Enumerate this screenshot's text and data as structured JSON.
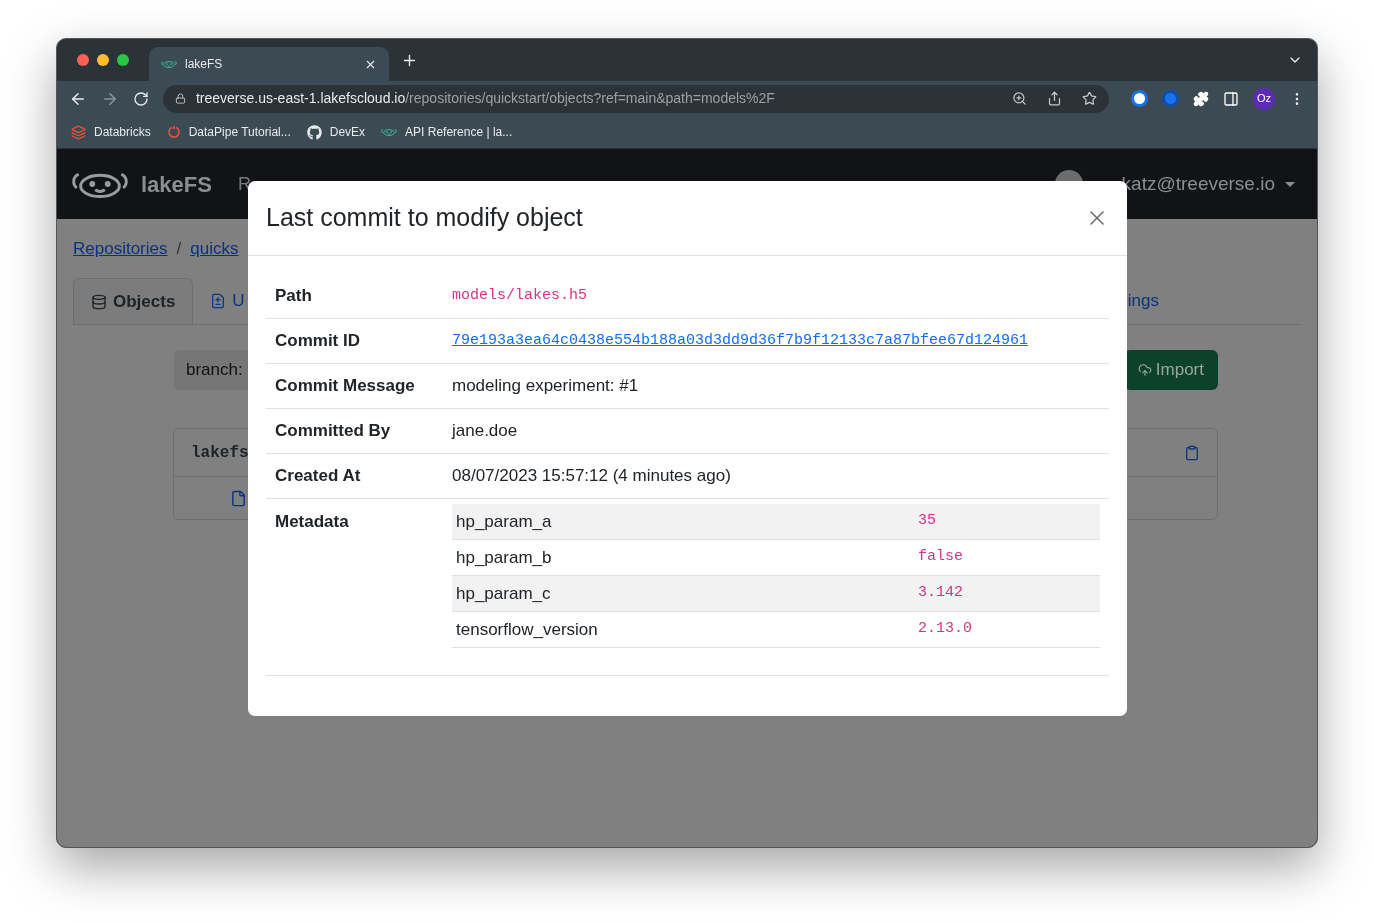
{
  "browser": {
    "tabs": [
      {
        "title": "lakeFS",
        "selected": true
      }
    ],
    "url": {
      "host": "treeverse.us-east-1.lakefscloud.io",
      "path": "/repositories/quickstart/objects?ref=main&path=models%2F"
    },
    "profile": "Oz",
    "bookmarks": [
      {
        "label": "Databricks",
        "kind": "layers"
      },
      {
        "label": "DataPipe Tutorial...",
        "kind": "ring"
      },
      {
        "label": "DevEx",
        "kind": "github"
      },
      {
        "label": "API Reference | la...",
        "kind": "axolotl"
      }
    ]
  },
  "app": {
    "brand": "lakeFS",
    "nav_partial": "R",
    "user": "katz@treeverse.io",
    "breadcrumbs": [
      {
        "label": "Repositories"
      },
      {
        "label": "quicks"
      }
    ],
    "breadcrumb_separator": "/",
    "tabs": [
      {
        "label": "Objects",
        "kind": "objects",
        "selected": true
      },
      {
        "label": "U",
        "kind": "uploads",
        "selected": false
      },
      {
        "label": "ings",
        "kind": "settings",
        "selected": false
      }
    ],
    "branch_label": "branch:",
    "import_button": "Import",
    "table_header": "lakefs"
  },
  "modal": {
    "title": "Last commit to modify object",
    "rows": [
      {
        "label": "Path",
        "kind": "code",
        "value": "models/lakes.h5"
      },
      {
        "label": "Commit ID",
        "kind": "link",
        "value": "79e193a3ea64c0438e554b188a03d3dd9d36f7b9f12133c7a87bfee67d124961"
      },
      {
        "label": "Commit Message",
        "kind": "text",
        "value": "modeling experiment: #1"
      },
      {
        "label": "Committed By",
        "kind": "text",
        "value": "jane.doe"
      },
      {
        "label": "Created At",
        "kind": "text",
        "value": "08/07/2023 15:57:12 (4 minutes ago)"
      },
      {
        "label": "Metadata",
        "kind": "metadata",
        "entries": [
          {
            "key": "hp_param_a",
            "value": "35"
          },
          {
            "key": "hp_param_b",
            "value": "false"
          },
          {
            "key": "hp_param_c",
            "value": "3.142"
          },
          {
            "key": "tensorflow_version",
            "value": "2.13.0"
          }
        ]
      }
    ]
  }
}
